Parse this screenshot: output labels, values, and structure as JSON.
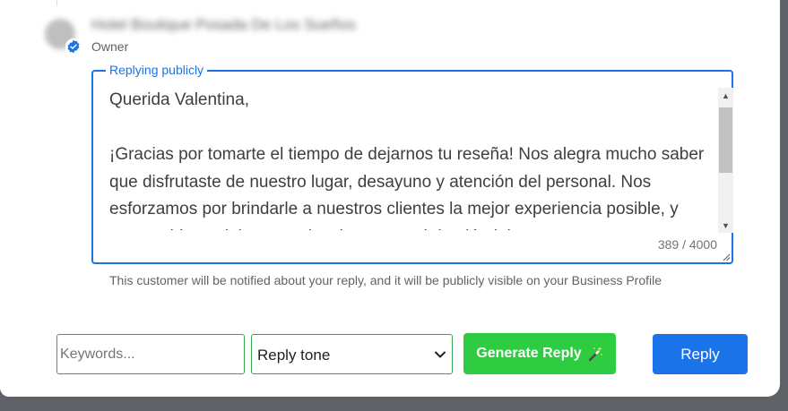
{
  "owner": {
    "name": "Hotel Boutique Posada De Los Sueños",
    "role": "Owner"
  },
  "reply": {
    "legend": "Replying publicly",
    "text": "Querida Valentina,\n\n¡Gracias por tomarte el tiempo de dejarnos tu reseña! Nos alegra mucho saber que disfrutaste de nuestro lugar, desayuno y atención del personal. Nos esforzamos por brindarle a nuestros clientes la mejor experiencia posible, y tus amables palabras nos inspiran a seguir haciéndolo.",
    "char_count": "389 / 4000",
    "notice": "This customer will be notified about your reply, and it will be publicly visible on your Business Profile"
  },
  "toolbar": {
    "keywords_placeholder": "Keywords...",
    "tone_selected": "Reply tone",
    "generate_label": "Generate Reply",
    "generate_icon": "magic-wand-icon",
    "reply_label": "Reply"
  },
  "colors": {
    "accent_blue": "#1a73e8",
    "generate_green": "#2ecc40",
    "field_border_green": "#2fa84f"
  }
}
